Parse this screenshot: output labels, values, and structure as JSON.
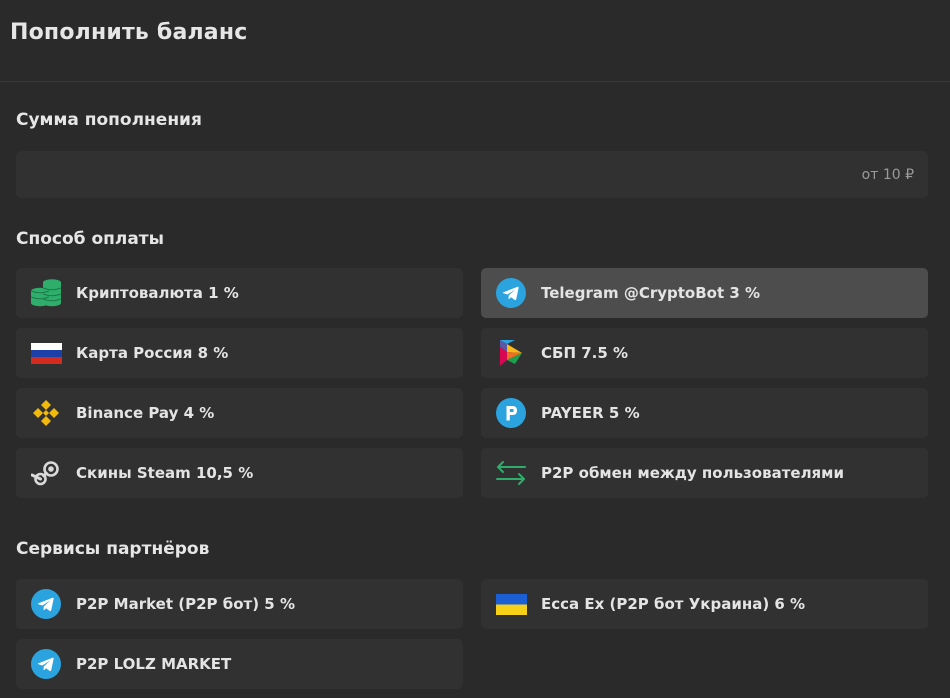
{
  "header": {
    "title": "Пополнить баланс"
  },
  "amount": {
    "title": "Сумма пополнения",
    "placeholder": "от 10 ₽"
  },
  "payment": {
    "title": "Способ оплаты",
    "methods": [
      {
        "label": "Криптовалюта 1 %",
        "icon": "coins-stack-icon"
      },
      {
        "label": "Telegram @CryptoBot 3 %",
        "icon": "telegram-icon",
        "selected": true
      },
      {
        "label": "Карта Россия 8 %",
        "icon": "russia-flag-icon"
      },
      {
        "label": "СБП 7.5 %",
        "icon": "sbp-logo-icon"
      },
      {
        "label": "Binance Pay 4 %",
        "icon": "binance-logo-icon"
      },
      {
        "label": "PAYEER 5 %",
        "icon": "payeer-logo-icon"
      },
      {
        "label": "Скины Steam 10,5 %",
        "icon": "steam-logo-icon"
      },
      {
        "label": "P2P обмен между пользователями",
        "icon": "exchange-arrows-icon"
      }
    ]
  },
  "partners": {
    "title": "Сервисы партнёров",
    "services": [
      {
        "label": "P2P Market (P2P бот) 5 %",
        "icon": "telegram-icon"
      },
      {
        "label": "Ecca Ex (P2P бот Украина) 6 %",
        "icon": "ukraine-flag-icon"
      },
      {
        "label": "P2P LOLZ MARKET",
        "icon": "telegram-icon"
      }
    ]
  },
  "colors": {
    "background": "#2a2a2a",
    "card": "#313131",
    "card_selected": "#4d4d4d",
    "telegram": "#2aa3df",
    "coins": "#2fae6b",
    "binance": "#f0b90b",
    "payeer": "#2aa3df",
    "exchange": "#2fae6b"
  }
}
